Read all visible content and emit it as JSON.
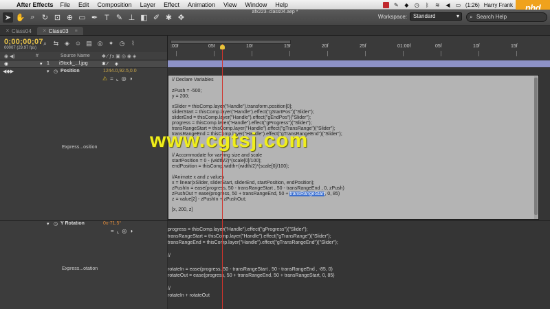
{
  "menubar": {
    "apple": "",
    "app_name": "After Effects",
    "items": [
      "File",
      "Edit",
      "Composition",
      "Layer",
      "Effect",
      "Animation",
      "View",
      "Window",
      "Help"
    ],
    "battery": "(1:26)",
    "user": "Harry Frank"
  },
  "logo": {
    "text": "phd",
    "color": "#f0a21c"
  },
  "toolbar": {
    "document_title": "afx223–class04.aep *",
    "workspace_label": "Workspace:",
    "workspace_value": "Standard",
    "search_placeholder": "Search Help"
  },
  "tabs": [
    {
      "label": "Class04"
    },
    {
      "label": "Class03"
    }
  ],
  "timeline": {
    "timecode": "0;00;00;07",
    "frames": "00007 (29.97 fps)",
    "column_header": {
      "num": "#",
      "source_name": "Source Name"
    },
    "layer": {
      "num": "1",
      "name": "iStock_...l.jpg",
      "color": "#8a8fc7"
    },
    "position": {
      "name": "Position",
      "value": "1244.0,92.5,0.0"
    },
    "position_expr_label": "Express...osition",
    "y_rotation": {
      "name": "Y Rotation",
      "value": "0x-71.5°"
    },
    "rotation_expr_label": "Express...otation",
    "ruler_ticks": [
      ":00f",
      "05f",
      "10f",
      "15f",
      "20f",
      "25f",
      "01:00f",
      "05f",
      "10f",
      "15f"
    ],
    "playhead_color": "#d0342c"
  },
  "position_expression": [
    "// Declare Variables",
    "",
    "zPush = -500;",
    "y = 200;",
    "",
    "xSlider = thisComp.layer(\"Handle\").transform.position[0];",
    "sliderStart = thisComp.layer(\"Handle\").effect(\"gStartPos\")(\"Slider\");",
    "sliderEnd = thisComp.layer(\"Handle\").effect(\"gEndPos\")(\"Slider\");",
    "progress = thisComp.layer(\"Handle\").effect(\"gProgress\")(\"Slider\");",
    "transRangeStart = thisComp.layer(\"Handle\").effect(\"gTransRange\")(\"Slider\");",
    "transRangeEnd = thisComp.layer(\"Handle\").effect(\"gTransRangeEnd\")(\"Slider\");",
    "",
    "",
    "",
    "// Accommodate for varying size and scale",
    "startPosition = 0 - (width/2)*(scale[0]/100);",
    "endPosition = thisComp.width+(width/2)*(scale[0]/100);",
    "",
    "//Animate x and z values",
    "x = linear(xSlider, sliderStart, sliderEnd, startPosition, endPosition);",
    "zPushIn = ease(progress, 50 - transRangeStart , 50 - transRangeEnd , 0, zPush)",
    "zPushOut = ease(progress, 50 + transRangeEnd, 50 + ",
    "z = value[2] - zPushIn + zPushOut;",
    "",
    "[x, 200, z]"
  ],
  "position_expression_highlight": {
    "selected": "transRangeStart",
    "after": ", 0, 85)"
  },
  "rotation_expression": [
    "progress = thisComp.layer(\"Handle\").effect(\"gProgress\")(\"Slider\");",
    "transRangeStart = thisComp.layer(\"Handle\").effect(\"gTransRange\")(\"Slider\");",
    "transRangeEnd = thisComp.layer(\"Handle\").effect(\"gTransRangeEnd\")(\"Slider\");",
    "",
    "//",
    "",
    "rotateIn = ease(progress, 50 - transRangeStart , 50 - transRangeEnd , -85, 0)",
    "rotateOut = ease(progress, 50 + transRangeEnd, 50 + transRangeStart, 0, 85)",
    "",
    "//",
    "rotateIn + rotateOut"
  ],
  "watermark": "www.cgtsj.com"
}
